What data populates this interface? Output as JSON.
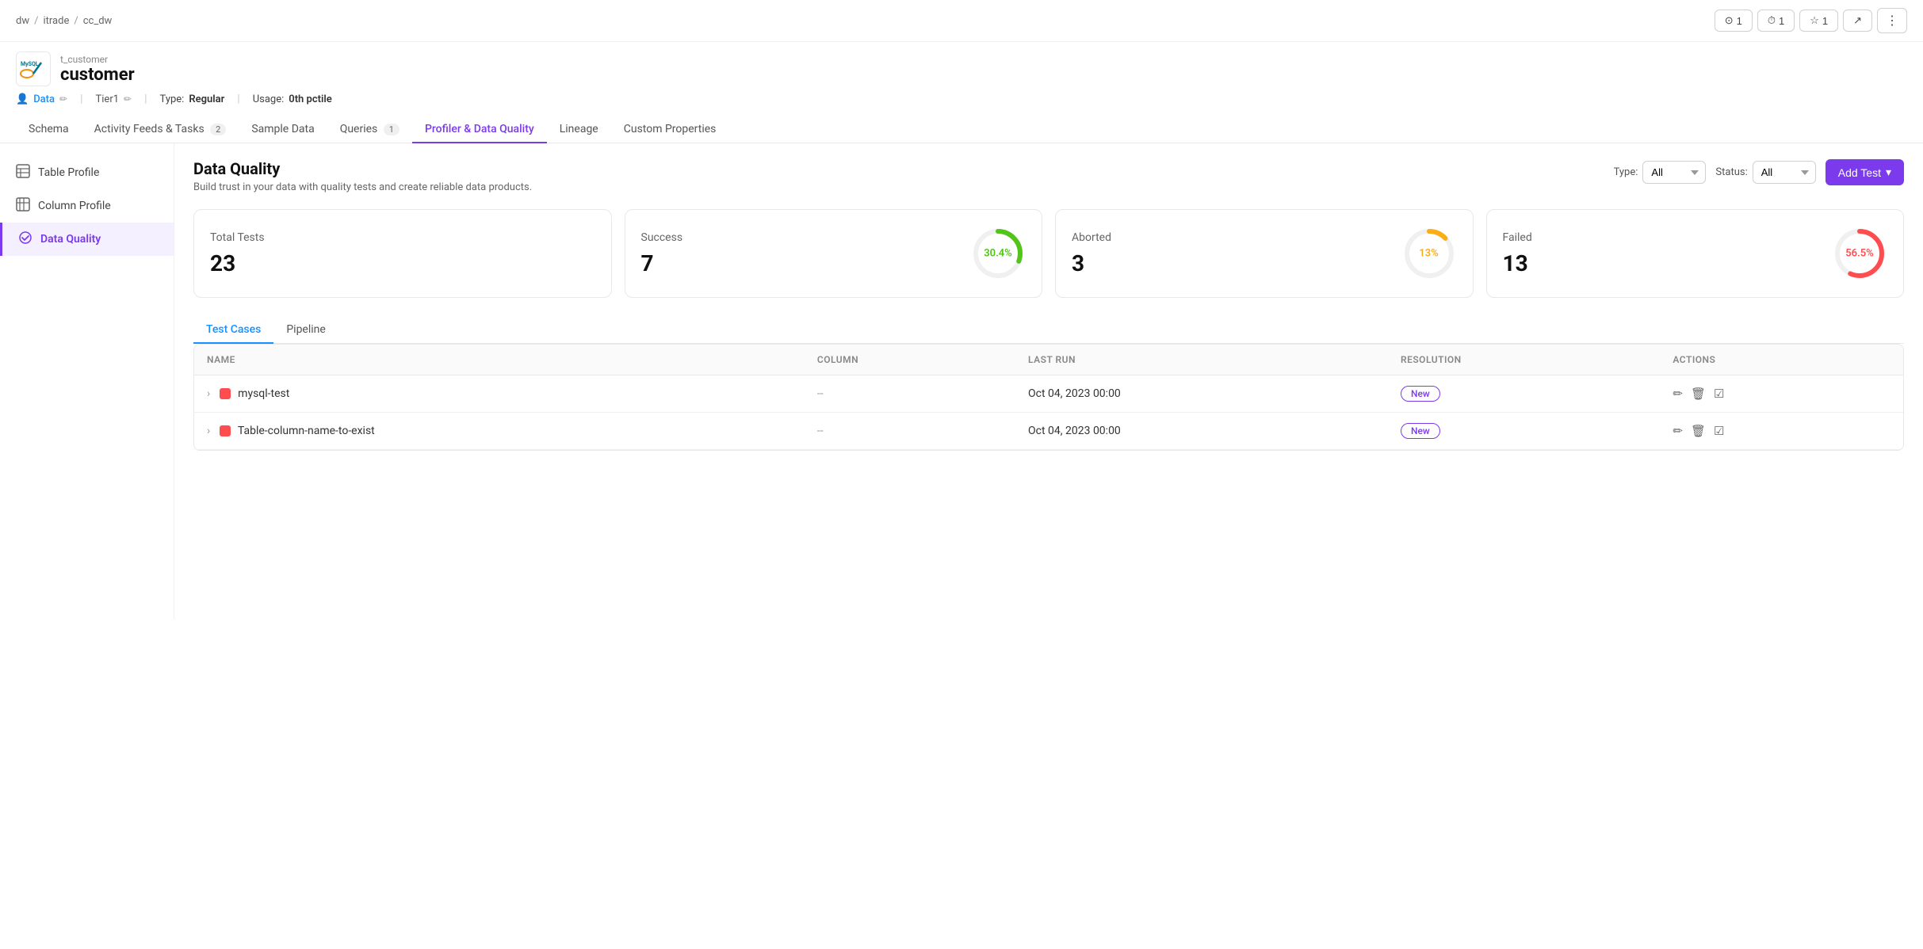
{
  "breadcrumb": {
    "items": [
      "dw",
      "itrade",
      "cc_dw"
    ]
  },
  "top_actions": [
    {
      "icon": "circle-check",
      "count": "1",
      "id": "mentions"
    },
    {
      "icon": "clock",
      "count": "1",
      "id": "history"
    },
    {
      "icon": "star",
      "count": "1",
      "id": "star"
    },
    {
      "icon": "share",
      "id": "share"
    }
  ],
  "entity": {
    "subtitle": "t_customer",
    "title": "customer",
    "logo_text": "MySQL"
  },
  "meta": {
    "owner_label": "Data",
    "tier": "Tier1",
    "type_label": "Type:",
    "type_value": "Regular",
    "usage_label": "Usage:",
    "usage_value": "0th pctile"
  },
  "tabs": [
    {
      "id": "schema",
      "label": "Schema",
      "badge": null
    },
    {
      "id": "activity",
      "label": "Activity Feeds & Tasks",
      "badge": "2"
    },
    {
      "id": "sample",
      "label": "Sample Data",
      "badge": null
    },
    {
      "id": "queries",
      "label": "Queries",
      "badge": "1"
    },
    {
      "id": "profiler",
      "label": "Profiler & Data Quality",
      "badge": null,
      "active": true
    },
    {
      "id": "lineage",
      "label": "Lineage",
      "badge": null
    },
    {
      "id": "custom",
      "label": "Custom Properties",
      "badge": null
    }
  ],
  "sidebar": {
    "items": [
      {
        "id": "table-profile",
        "label": "Table Profile",
        "icon": "📊"
      },
      {
        "id": "column-profile",
        "label": "Column Profile",
        "icon": "📋"
      },
      {
        "id": "data-quality",
        "label": "Data Quality",
        "icon": "🛡",
        "active": true
      }
    ]
  },
  "data_quality": {
    "title": "Data Quality",
    "description": "Build trust in your data with quality tests and create reliable data products.",
    "type_label": "Type:",
    "type_options": [
      "All"
    ],
    "type_value": "All",
    "status_label": "Status:",
    "status_options": [
      "All"
    ],
    "status_value": "All",
    "add_test_label": "Add Test"
  },
  "stats": [
    {
      "id": "total",
      "label": "Total Tests",
      "value": "23",
      "show_donut": false
    },
    {
      "id": "success",
      "label": "Success",
      "value": "7",
      "show_donut": true,
      "percent": "30.4%",
      "color": "green",
      "stroke": "#52c41a",
      "bg": "#e6f7e6",
      "offset": 69
    },
    {
      "id": "aborted",
      "label": "Aborted",
      "value": "3",
      "show_donut": true,
      "percent": "13%",
      "color": "yellow",
      "stroke": "#faad14",
      "bg": "#fff7e6",
      "offset": 87
    },
    {
      "id": "failed",
      "label": "Failed",
      "value": "13",
      "show_donut": true,
      "percent": "56.5%",
      "color": "red",
      "stroke": "#ff4d4f",
      "bg": "#fff1f0",
      "offset": 43
    }
  ],
  "test_tabs": [
    {
      "id": "test-cases",
      "label": "Test Cases",
      "active": true
    },
    {
      "id": "pipeline",
      "label": "Pipeline",
      "active": false
    }
  ],
  "table_headers": [
    "NAME",
    "COLUMN",
    "LAST RUN",
    "RESOLUTION",
    "ACTIONS"
  ],
  "test_rows": [
    {
      "id": "mysql-test",
      "name": "mysql-test",
      "column": "--",
      "last_run": "Oct 04, 2023 00:00",
      "resolution": "New",
      "status_color": "#ff4d4f"
    },
    {
      "id": "table-column-name",
      "name": "Table-column-name-to-exist",
      "column": "--",
      "last_run": "Oct 04, 2023 00:00",
      "resolution": "New",
      "status_color": "#ff4d4f"
    }
  ]
}
